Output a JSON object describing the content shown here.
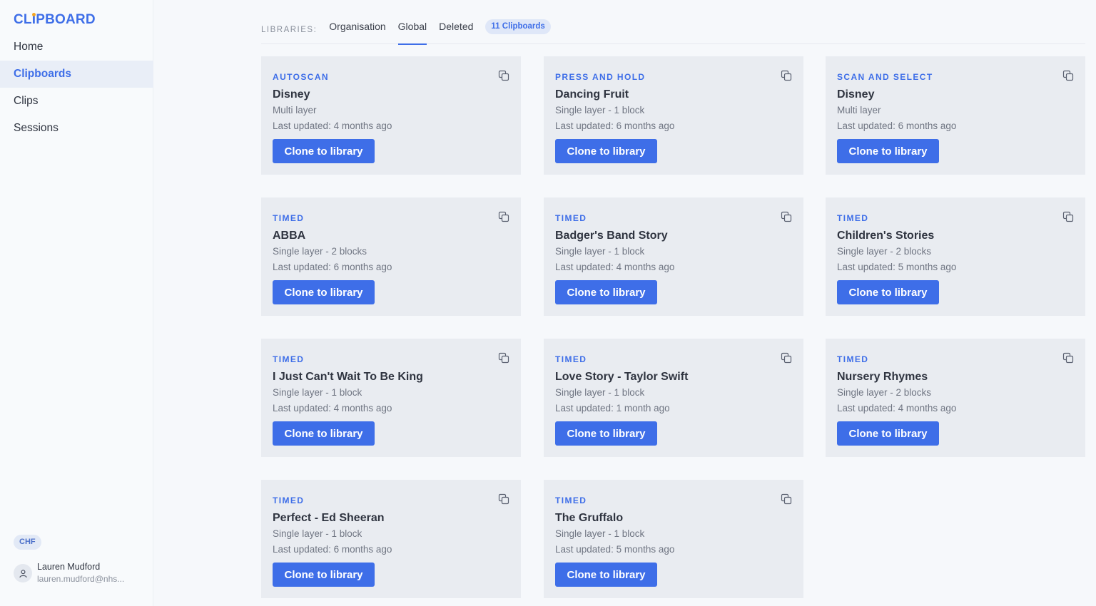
{
  "brand": {
    "logo_text_a": "CL",
    "logo_text_i": "I",
    "logo_text_b": "PBOARD"
  },
  "colors": {
    "accent": "#3e6ee8",
    "logo_dot": "#f5a623",
    "card_bg": "#e9ecf1"
  },
  "sidebar": {
    "items": [
      {
        "label": "Home",
        "active": false
      },
      {
        "label": "Clipboards",
        "active": true
      },
      {
        "label": "Clips",
        "active": false
      },
      {
        "label": "Sessions",
        "active": false
      }
    ],
    "org_badge": "CHF",
    "user": {
      "name": "Lauren Mudford",
      "email": "lauren.mudford@nhs..."
    }
  },
  "libraries": {
    "label": "LIBRARIES:",
    "tabs": [
      {
        "label": "Organisation",
        "active": false
      },
      {
        "label": "Global",
        "active": true
      },
      {
        "label": "Deleted",
        "active": false
      }
    ],
    "count": "11 Clipboards"
  },
  "cards": [
    {
      "type": "AUTOSCAN",
      "title": "Disney",
      "sub": "Multi layer",
      "updated": "Last updated: 4 months ago",
      "button": "Clone to library",
      "icon": "copy-icon"
    },
    {
      "type": "PRESS AND HOLD",
      "title": "Dancing Fruit",
      "sub": "Single layer - 1 block",
      "updated": "Last updated: 6 months ago",
      "button": "Clone to library",
      "icon": "copy-icon"
    },
    {
      "type": "SCAN AND SELECT",
      "title": "Disney",
      "sub": "Multi layer",
      "updated": "Last updated: 6 months ago",
      "button": "Clone to library",
      "icon": "copy-icon"
    },
    {
      "type": "TIMED",
      "title": "ABBA",
      "sub": "Single layer - 2 blocks",
      "updated": "Last updated: 6 months ago",
      "button": "Clone to library",
      "icon": "copy-icon"
    },
    {
      "type": "TIMED",
      "title": "Badger's Band Story",
      "sub": "Single layer - 1 block",
      "updated": "Last updated: 4 months ago",
      "button": "Clone to library",
      "icon": "copy-icon"
    },
    {
      "type": "TIMED",
      "title": "Children's Stories",
      "sub": "Single layer - 2 blocks",
      "updated": "Last updated: 5 months ago",
      "button": "Clone to library",
      "icon": "copy-icon"
    },
    {
      "type": "TIMED",
      "title": "I Just Can't Wait To Be King",
      "sub": "Single layer - 1 block",
      "updated": "Last updated: 4 months ago",
      "button": "Clone to library",
      "icon": "copy-icon"
    },
    {
      "type": "TIMED",
      "title": "Love Story - Taylor Swift",
      "sub": "Single layer - 1 block",
      "updated": "Last updated: 1 month ago",
      "button": "Clone to library",
      "icon": "copy-icon"
    },
    {
      "type": "TIMED",
      "title": "Nursery Rhymes",
      "sub": "Single layer - 2 blocks",
      "updated": "Last updated: 4 months ago",
      "button": "Clone to library",
      "icon": "copy-icon"
    },
    {
      "type": "TIMED",
      "title": "Perfect - Ed Sheeran",
      "sub": "Single layer - 1 block",
      "updated": "Last updated: 6 months ago",
      "button": "Clone to library",
      "icon": "copy-icon"
    },
    {
      "type": "TIMED",
      "title": "The Gruffalo",
      "sub": "Single layer - 1 block",
      "updated": "Last updated: 5 months ago",
      "button": "Clone to library",
      "icon": "copy-icon"
    }
  ]
}
